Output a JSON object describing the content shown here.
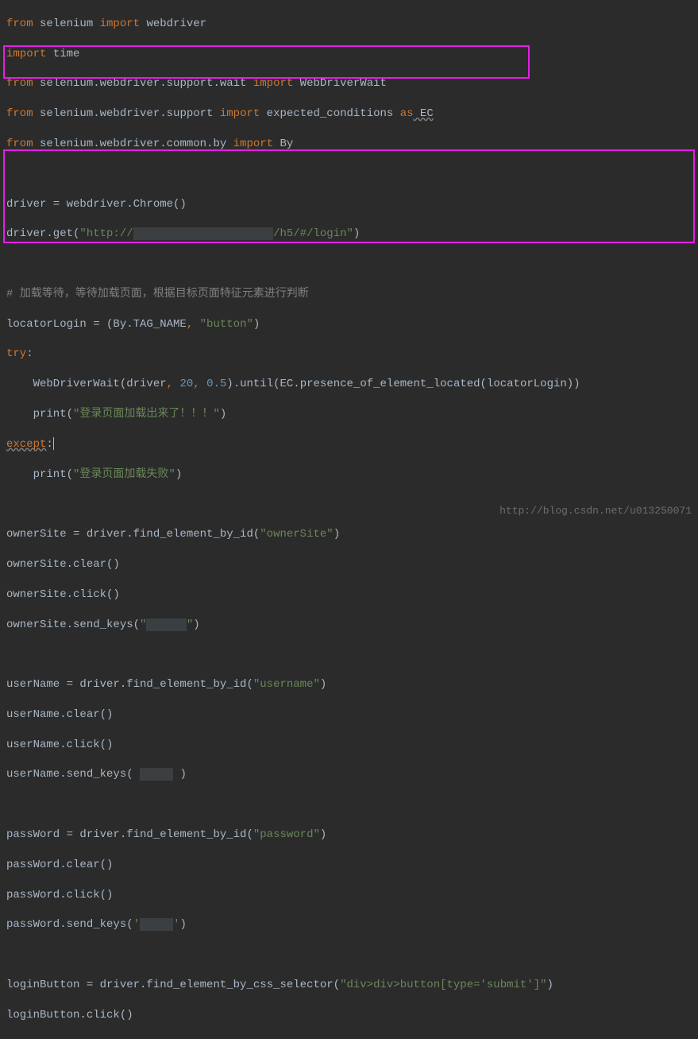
{
  "lines": {
    "l1_from": "from",
    "l1_mod": " selenium ",
    "l1_import": "import",
    "l1_item": " webdriver",
    "l2_import": "import",
    "l2_item": " time",
    "l3_from": "from",
    "l3_mod": " selenium.webdriver.support.wait ",
    "l3_import": "import",
    "l3_item": " WebDriverWait",
    "l4_from": "from",
    "l4_mod": " selenium.webdriver.support ",
    "l4_import": "import",
    "l4_item": " expected_conditions ",
    "l4_as": "as",
    "l4_alias": " EC",
    "l5_from": "from",
    "l5_mod": " selenium.webdriver.common.by ",
    "l5_import": "import",
    "l5_item": " By",
    "l7": "driver = webdriver.Chrome()",
    "l8_a": "driver.get(",
    "l8_b": "\"http://",
    "l8_c": "/h5/#/login\"",
    "l8_d": ")",
    "l10": "# 加载等待，等待加载页面，根据目标页面特征元素进行判断",
    "l11_a": "locatorLogin = (By.TAG_NAME",
    "l11_b": ", ",
    "l11_c": "\"button\"",
    "l11_d": ")",
    "l12": "try",
    "l12_colon": ":",
    "l13_a": "    WebDriverWait(driver",
    "l13_b": ", ",
    "l13_c": "20",
    "l13_d": ", ",
    "l13_e": "0.5",
    "l13_f": ").until(EC.presence_of_element_located(locatorLogin))",
    "l14_a": "    print(",
    "l14_b": "\"登录页面加载出来了！！！\"",
    "l14_c": ")",
    "l15": "except",
    "l15_colon": ":",
    "l16_a": "    print(",
    "l16_b": "\"登录页面加载失败\"",
    "l16_c": ")",
    "l18_a": "ownerSite = driver.find_element_by_id(",
    "l18_b": "\"ownerSite\"",
    "l18_c": ")",
    "l19": "ownerSite.clear()",
    "l20": "ownerSite.click()",
    "l21_a": "ownerSite.send_keys(",
    "l21_b": "\"",
    "l21_c": "\"",
    "l21_d": ")",
    "l23_a": "userName = driver.find_element_by_id(",
    "l23_b": "\"username\"",
    "l23_c": ")",
    "l24": "userName.clear()",
    "l25": "userName.click()",
    "l26_a": "userName.send_keys( ",
    "l26_d": " )",
    "l28_a": "passWord = driver.find_element_by_id(",
    "l28_b": "\"password\"",
    "l28_c": ")",
    "l29": "passWord.clear()",
    "l30": "passWord.click()",
    "l31_a": "passWord.send_keys(",
    "l31_b": "'",
    "l31_c": "'",
    "l31_d": ")",
    "l33_a": "loginButton = driver.find_element_by_css_selector(",
    "l33_b": "\"div>div>button[type='submit']\"",
    "l33_c": ")",
    "l34": "loginButton.click()"
  },
  "watermark": "http://blog.csdn.net/u013250071"
}
